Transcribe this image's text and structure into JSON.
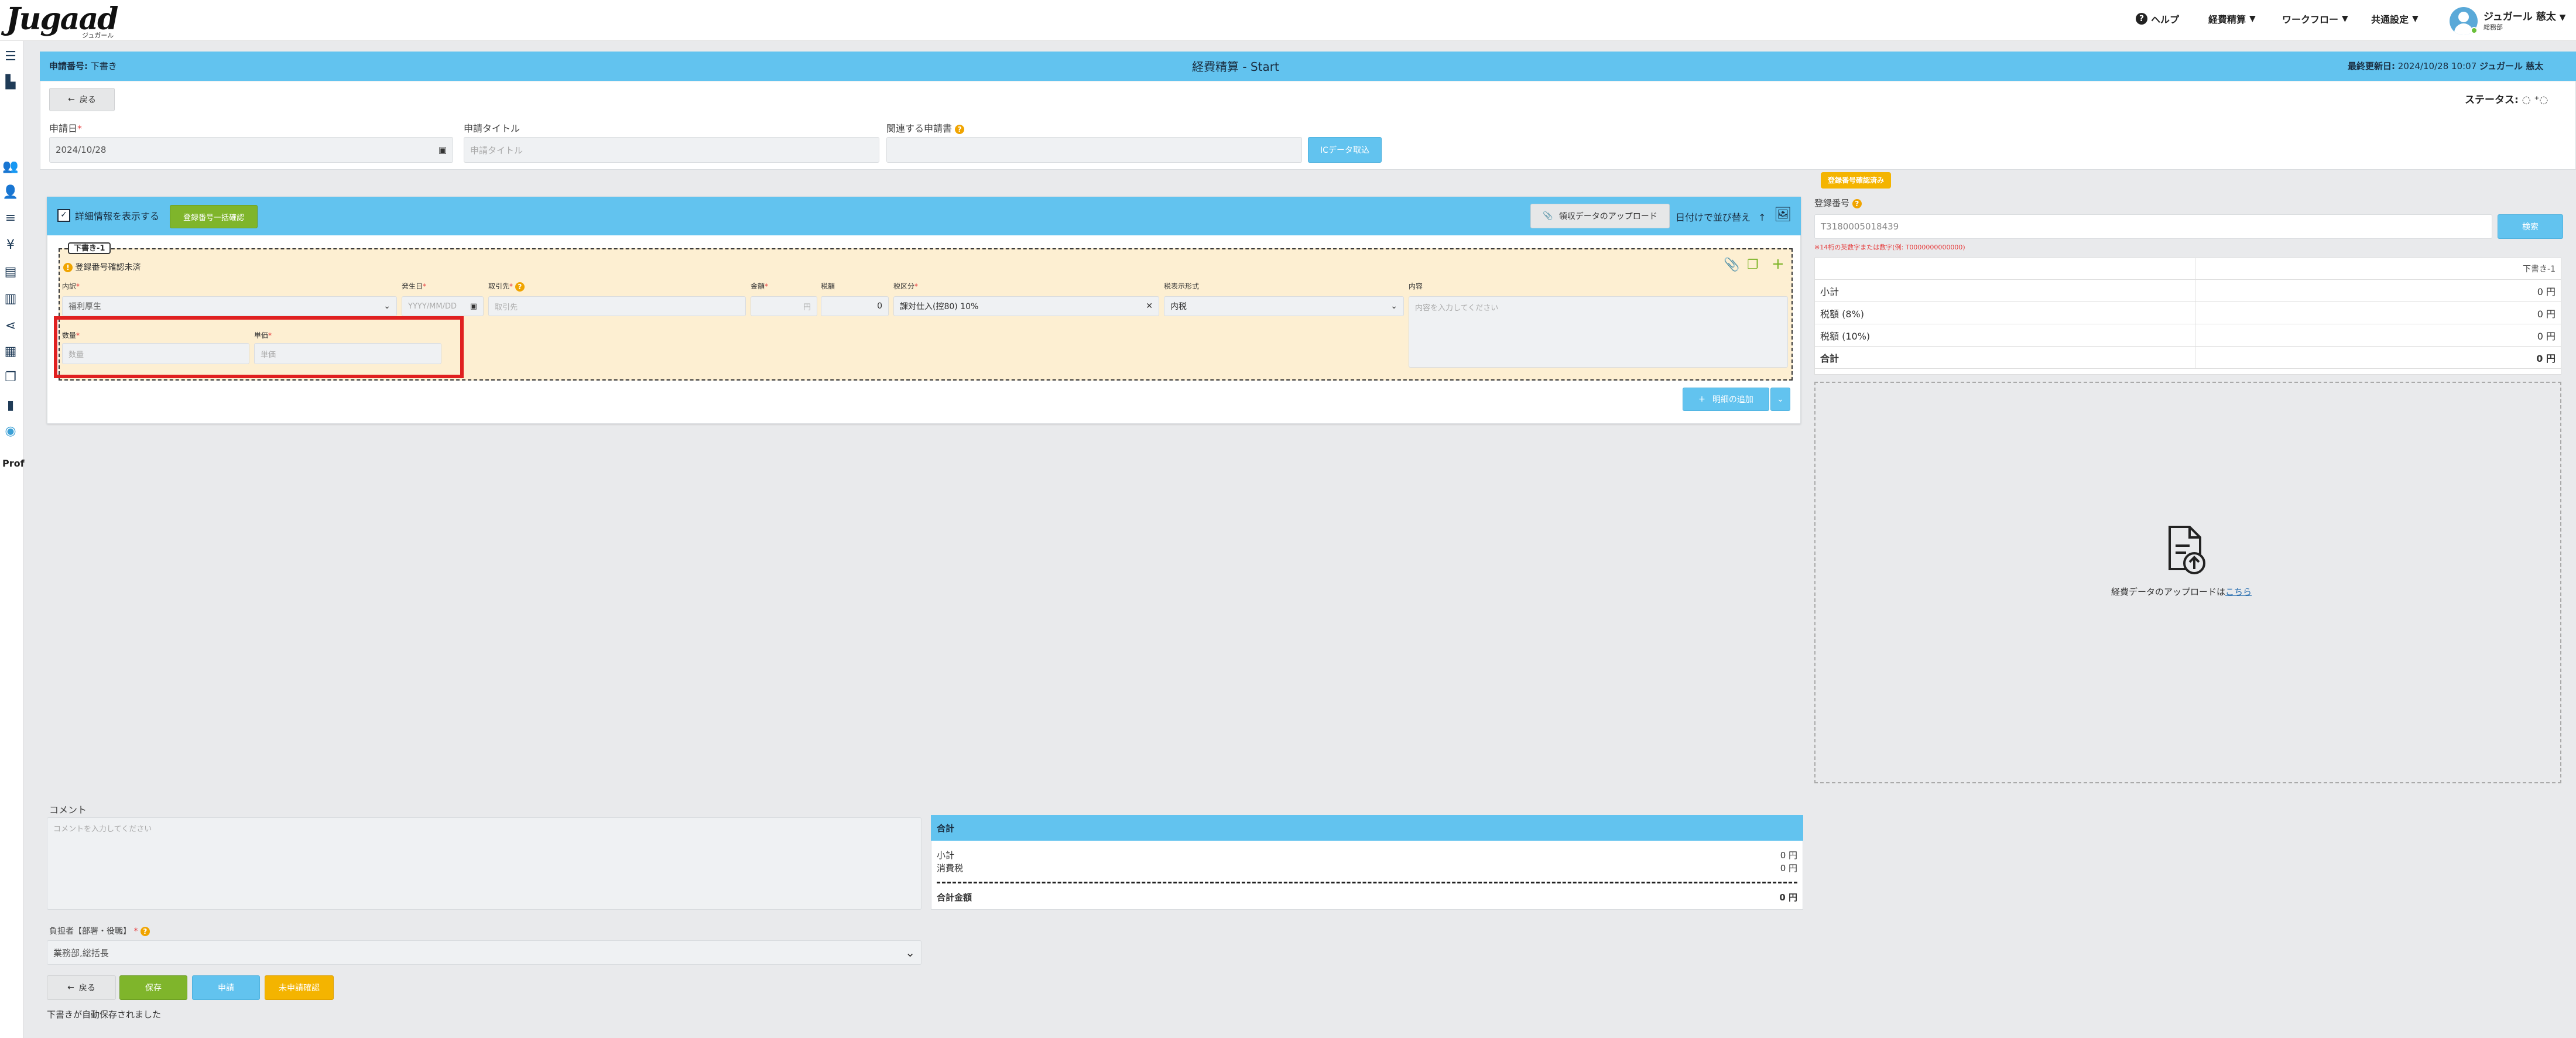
{
  "header": {
    "logo": "Jugaad",
    "logo_sub": "ジュガール",
    "menu": {
      "help": "ヘルプ",
      "expense": "経費精算",
      "workflow": "ワークフロー",
      "settings": "共通設定"
    },
    "user_name": "ジュガール 慈太",
    "user_dept": "総務部"
  },
  "titlebar": {
    "app_no_label": "申請番号:",
    "app_no_value": "下書き",
    "title": "経費精算 - Start",
    "updated_label": "最終更新日:",
    "updated_value": "2024/10/28 10:07",
    "updated_user": "ジュガール 慈太"
  },
  "top": {
    "back_label": "戻る",
    "status_label": "ステータス:",
    "date_label": "申請日",
    "date_value": "2024/10/28",
    "title_label": "申請タイトル",
    "title_placeholder": "申請タイトル",
    "approver_label": "関連する申請書",
    "ic_button": "ICデータ取込"
  },
  "detail": {
    "show_detail_label": "詳細情報を表示する",
    "bulk_confirm_button": "登録番号一括確認",
    "upload_receipt_button": "領収データのアップロード",
    "sort_by_date_label": "日付けで並び替え",
    "card_tag": "下書き-1",
    "warning_text": "登録番号確認未済",
    "fields": {
      "item_label": "内訳",
      "item_value": "福利厚生",
      "date_label": "発生日",
      "date_placeholder": "YYYY/MM/DD",
      "payee_label": "取引先",
      "payee_placeholder": "取引先",
      "amount_label": "金額",
      "amount_unit": "円",
      "tax_label": "税額",
      "tax_value": "0",
      "taxtype_label": "税区分",
      "taxtype_value": "課対仕入(控80) 10%",
      "taxcalc_label": "税表示形式",
      "taxcalc_value": "内税",
      "content_label": "内容",
      "content_placeholder": "内容を入力してください",
      "qty_label": "数量",
      "qty_placeholder": "数量",
      "unit_label": "単価",
      "unit_placeholder": "単価"
    },
    "add_detail_button": "明細の追加"
  },
  "right": {
    "badge": "登録番号確認済み",
    "reg_label": "登録番号",
    "reg_value": "T3180005018439",
    "reg_note": "※14桁の英数字または数字(例: T0000000000000)",
    "search_button": "検索",
    "table_header": "下書き-1",
    "rows": [
      {
        "label": "小計",
        "value": "0 円"
      },
      {
        "label": "税額 (8%)",
        "value": "0 円"
      },
      {
        "label": "税額 (10%)",
        "value": "0 円"
      },
      {
        "label": "合計",
        "value": "0 円"
      }
    ],
    "upload_text": "経費データのアップロードは",
    "upload_link": "こちら"
  },
  "bottom": {
    "comment_label": "コメント",
    "comment_placeholder": "コメントを入力してください",
    "total_header": "合計",
    "subtotal_label": "小計",
    "subtotal_value": "0 円",
    "consumption_label": "消費税",
    "consumption_value": "0 円",
    "grand_label": "合計金額",
    "grand_value": "0 円",
    "burden_label": "負担者【部署・役職】",
    "burden_value": "業務部,総括長",
    "back_button": "戻る",
    "save_button": "保存",
    "apply_button": "申請",
    "approve_button": "未申請確認",
    "autosave_text": "下書きが自動保存されました"
  },
  "sidebar": {
    "profile_label": "Prof"
  },
  "colors": {
    "accent": "#62c3ef",
    "highlight_box": "#e02020",
    "card_bg": "#fdefd2",
    "save": "#7fb52b",
    "warn": "#f4b400"
  }
}
